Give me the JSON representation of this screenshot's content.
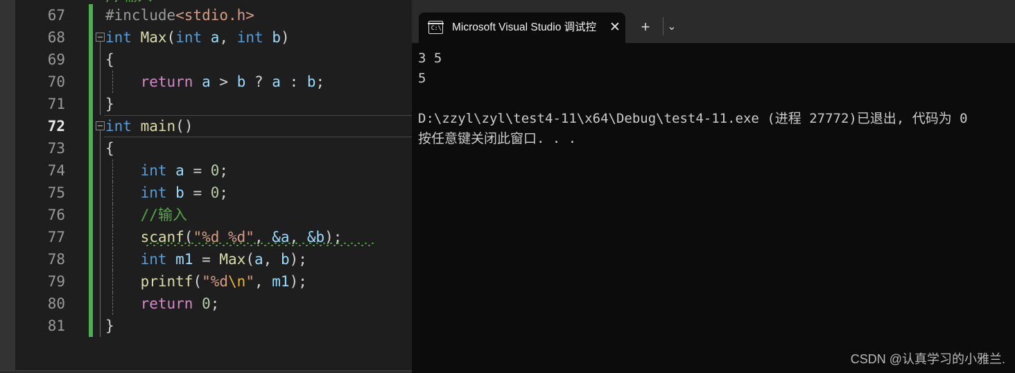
{
  "editor": {
    "clipped_top_line": "//输入",
    "current_line_number": 72,
    "lines": [
      {
        "num": "67",
        "indent": 0,
        "tokens": [
          {
            "t": "#include",
            "c": "s-pre"
          },
          {
            "t": "<stdio.h>",
            "c": "s-inc"
          }
        ]
      },
      {
        "num": "68",
        "indent": 0,
        "fold": true,
        "tokens": [
          {
            "t": "int",
            "c": "s-kw"
          },
          {
            "t": " ",
            "c": "s-plain"
          },
          {
            "t": "Max",
            "c": "s-fn"
          },
          {
            "t": "(",
            "c": "s-br"
          },
          {
            "t": "int",
            "c": "s-kw"
          },
          {
            "t": " ",
            "c": "s-plain"
          },
          {
            "t": "a",
            "c": "s-id"
          },
          {
            "t": ", ",
            "c": "s-plain"
          },
          {
            "t": "int",
            "c": "s-kw"
          },
          {
            "t": " ",
            "c": "s-plain"
          },
          {
            "t": "b",
            "c": "s-id"
          },
          {
            "t": ")",
            "c": "s-br"
          }
        ]
      },
      {
        "num": "69",
        "indent": 0,
        "tokens": [
          {
            "t": "{",
            "c": "s-br"
          }
        ]
      },
      {
        "num": "70",
        "indent": 1,
        "tokens": [
          {
            "t": "    ",
            "c": "s-plain"
          },
          {
            "t": "return",
            "c": "s-ctl"
          },
          {
            "t": " ",
            "c": "s-plain"
          },
          {
            "t": "a",
            "c": "s-id"
          },
          {
            "t": " > ",
            "c": "s-plain"
          },
          {
            "t": "b",
            "c": "s-id"
          },
          {
            "t": " ? ",
            "c": "s-plain"
          },
          {
            "t": "a",
            "c": "s-id"
          },
          {
            "t": " : ",
            "c": "s-plain"
          },
          {
            "t": "b",
            "c": "s-id"
          },
          {
            "t": ";",
            "c": "s-plain"
          }
        ]
      },
      {
        "num": "71",
        "indent": 0,
        "tokens": [
          {
            "t": "}",
            "c": "s-br"
          }
        ]
      },
      {
        "num": "72",
        "indent": 0,
        "fold": true,
        "current": true,
        "tokens": [
          {
            "t": "int",
            "c": "s-kw"
          },
          {
            "t": " ",
            "c": "s-plain"
          },
          {
            "t": "main",
            "c": "s-fn"
          },
          {
            "t": "()",
            "c": "s-br"
          }
        ]
      },
      {
        "num": "73",
        "indent": 0,
        "tokens": [
          {
            "t": "{",
            "c": "s-br"
          }
        ]
      },
      {
        "num": "74",
        "indent": 1,
        "tokens": [
          {
            "t": "    ",
            "c": "s-plain"
          },
          {
            "t": "int",
            "c": "s-kw"
          },
          {
            "t": " ",
            "c": "s-plain"
          },
          {
            "t": "a",
            "c": "s-id"
          },
          {
            "t": " = ",
            "c": "s-plain"
          },
          {
            "t": "0",
            "c": "s-num"
          },
          {
            "t": ";",
            "c": "s-plain"
          }
        ]
      },
      {
        "num": "75",
        "indent": 1,
        "tokens": [
          {
            "t": "    ",
            "c": "s-plain"
          },
          {
            "t": "int",
            "c": "s-kw"
          },
          {
            "t": " ",
            "c": "s-plain"
          },
          {
            "t": "b",
            "c": "s-id"
          },
          {
            "t": " = ",
            "c": "s-plain"
          },
          {
            "t": "0",
            "c": "s-num"
          },
          {
            "t": ";",
            "c": "s-plain"
          }
        ]
      },
      {
        "num": "76",
        "indent": 1,
        "tokens": [
          {
            "t": "    ",
            "c": "s-plain"
          },
          {
            "t": "//输入",
            "c": "s-cmt"
          }
        ]
      },
      {
        "num": "77",
        "indent": 1,
        "squiggle": true,
        "tokens": [
          {
            "t": "    ",
            "c": "s-plain"
          },
          {
            "t": "scanf",
            "c": "s-fn"
          },
          {
            "t": "(",
            "c": "s-br"
          },
          {
            "t": "\"%d %d\"",
            "c": "s-str"
          },
          {
            "t": ", ",
            "c": "s-plain"
          },
          {
            "t": "&a",
            "c": "s-id"
          },
          {
            "t": ", ",
            "c": "s-plain"
          },
          {
            "t": "&b",
            "c": "s-id"
          },
          {
            "t": ");",
            "c": "s-br"
          }
        ]
      },
      {
        "num": "78",
        "indent": 1,
        "tokens": [
          {
            "t": "    ",
            "c": "s-plain"
          },
          {
            "t": "int",
            "c": "s-kw"
          },
          {
            "t": " ",
            "c": "s-plain"
          },
          {
            "t": "m1",
            "c": "s-id"
          },
          {
            "t": " = ",
            "c": "s-plain"
          },
          {
            "t": "Max",
            "c": "s-fn"
          },
          {
            "t": "(",
            "c": "s-br"
          },
          {
            "t": "a",
            "c": "s-id"
          },
          {
            "t": ", ",
            "c": "s-plain"
          },
          {
            "t": "b",
            "c": "s-id"
          },
          {
            "t": ");",
            "c": "s-br"
          }
        ]
      },
      {
        "num": "79",
        "indent": 1,
        "tokens": [
          {
            "t": "    ",
            "c": "s-plain"
          },
          {
            "t": "printf",
            "c": "s-fn"
          },
          {
            "t": "(",
            "c": "s-br"
          },
          {
            "t": "\"%d",
            "c": "s-str"
          },
          {
            "t": "\\n",
            "c": "s-esc"
          },
          {
            "t": "\"",
            "c": "s-str"
          },
          {
            "t": ", ",
            "c": "s-plain"
          },
          {
            "t": "m1",
            "c": "s-id"
          },
          {
            "t": ");",
            "c": "s-br"
          }
        ]
      },
      {
        "num": "80",
        "indent": 1,
        "tokens": [
          {
            "t": "    ",
            "c": "s-plain"
          },
          {
            "t": "return",
            "c": "s-ctl"
          },
          {
            "t": " ",
            "c": "s-plain"
          },
          {
            "t": "0",
            "c": "s-num"
          },
          {
            "t": ";",
            "c": "s-plain"
          }
        ]
      },
      {
        "num": "81",
        "indent": 0,
        "tokens": [
          {
            "t": "}",
            "c": "s-br"
          }
        ]
      }
    ]
  },
  "terminal": {
    "tab": {
      "icon_label": "C:\\",
      "title": "Microsoft Visual Studio 调试控",
      "close_label": "✕"
    },
    "new_tab_label": "+",
    "menu_label": "⌄",
    "output_lines": [
      "3 5",
      "5",
      "",
      "D:\\zzyl\\zyl\\test4-11\\x64\\Debug\\test4-11.exe (进程 27772)已退出, 代码为 0",
      "按任意键关闭此窗口. . ."
    ]
  },
  "watermark": "CSDN @认真学习的小雅兰.",
  "colors": {
    "editor_bg": "#1e1e1e",
    "terminal_bg": "#0c0c0c",
    "tabbar_bg": "#2b2b2b",
    "change_bar": "#4caf50",
    "keyword": "#569cd6",
    "function": "#dcdcaa",
    "string": "#d69d85",
    "comment": "#57a64a",
    "number": "#b5cea8",
    "control": "#d08ac9",
    "identifier": "#9cdcfe"
  }
}
